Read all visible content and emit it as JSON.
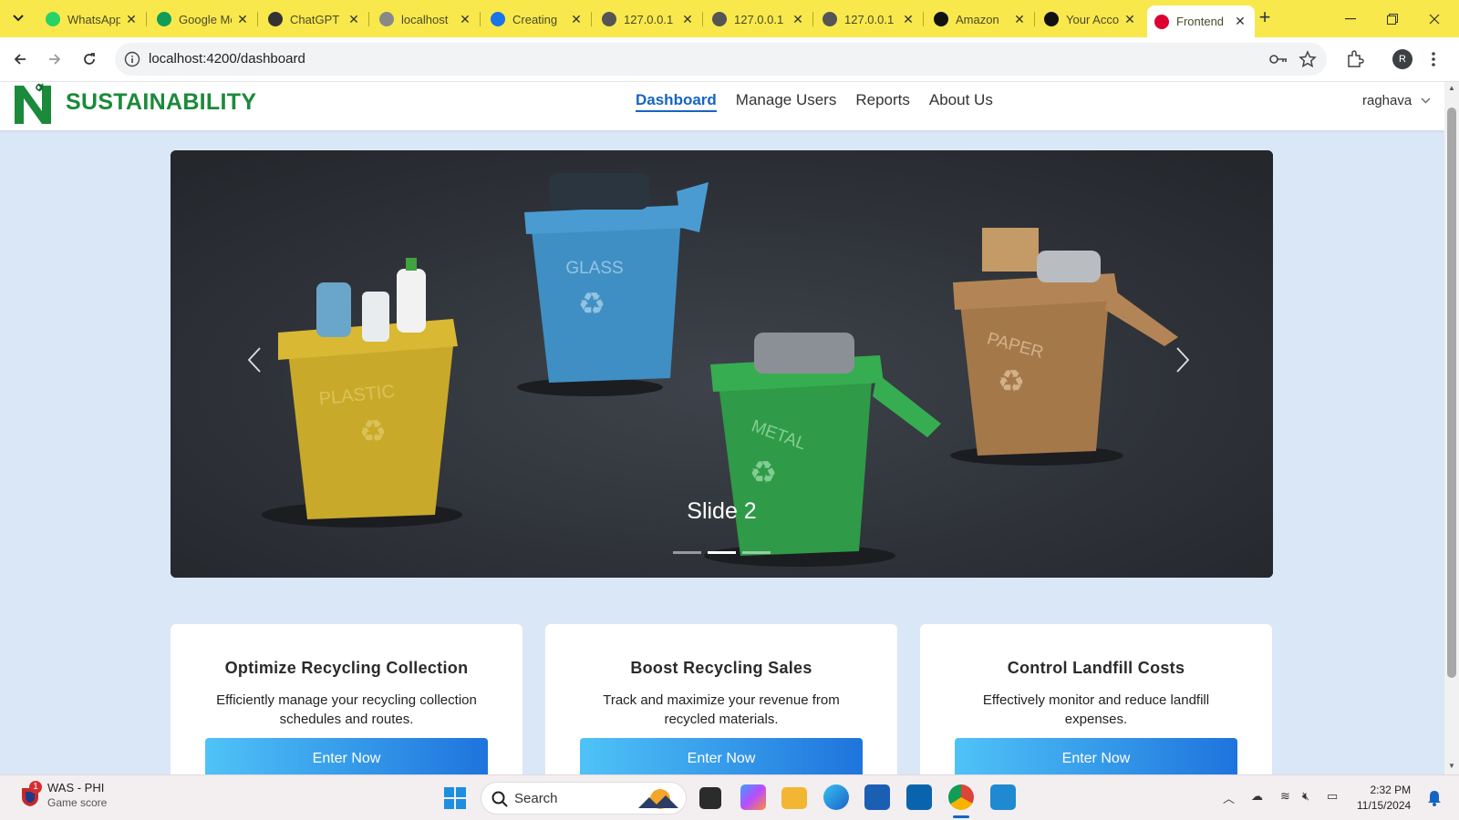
{
  "browser": {
    "tabs": [
      {
        "title": "WhatsApp",
        "icon": "whatsapp-icon",
        "color": "#25d366"
      },
      {
        "title": "Google Meet",
        "icon": "google-meet-icon",
        "color": "#0f9d58"
      },
      {
        "title": "ChatGPT",
        "icon": "chatgpt-icon",
        "color": "#333333"
      },
      {
        "title": "localhost",
        "icon": "angular-icon",
        "color": "#888888"
      },
      {
        "title": "Creating",
        "icon": "c-icon",
        "color": "#1a73e8"
      },
      {
        "title": "127.0.0.1",
        "icon": "globe-icon",
        "color": "#555555"
      },
      {
        "title": "127.0.0.1",
        "icon": "globe-icon",
        "color": "#555555"
      },
      {
        "title": "127.0.0.1",
        "icon": "globe-icon",
        "color": "#555555"
      },
      {
        "title": "Amazon",
        "icon": "amazon-icon",
        "color": "#111111"
      },
      {
        "title": "Your Account",
        "icon": "amazon-icon",
        "color": "#111111"
      },
      {
        "title": "Frontend",
        "icon": "angular-icon",
        "color": "#dd0031",
        "active": true
      }
    ],
    "url": "localhost:4200/dashboard",
    "profile_initial": "R",
    "theme_color": "#f9e84c"
  },
  "app": {
    "brand": "SUSTAINABILITY",
    "brand_color": "#1b8a3a",
    "nav": [
      {
        "label": "Dashboard",
        "active": true
      },
      {
        "label": "Manage Users"
      },
      {
        "label": "Reports"
      },
      {
        "label": "About Us"
      }
    ],
    "user": "raghava"
  },
  "carousel": {
    "caption": "Slide 2",
    "active_index": 1,
    "slide_count": 3,
    "bin_labels": [
      "PLASTIC",
      "GLASS",
      "METAL",
      "PAPER"
    ]
  },
  "cards": [
    {
      "title": "Optimize Recycling Collection",
      "text": "Efficiently manage your recycling collection schedules and routes.",
      "button": "Enter Now"
    },
    {
      "title": "Boost Recycling Sales",
      "text": "Track and maximize your revenue from recycled materials.",
      "button": "Enter Now"
    },
    {
      "title": "Control Landfill Costs",
      "text": "Effectively monitor and reduce landfill expenses.",
      "button": "Enter Now"
    }
  ],
  "taskbar": {
    "widget_title": "WAS - PHI",
    "widget_sub": "Game score",
    "widget_badge": "1",
    "search_label": "Search",
    "time": "2:32 PM",
    "date": "11/15/2024"
  }
}
